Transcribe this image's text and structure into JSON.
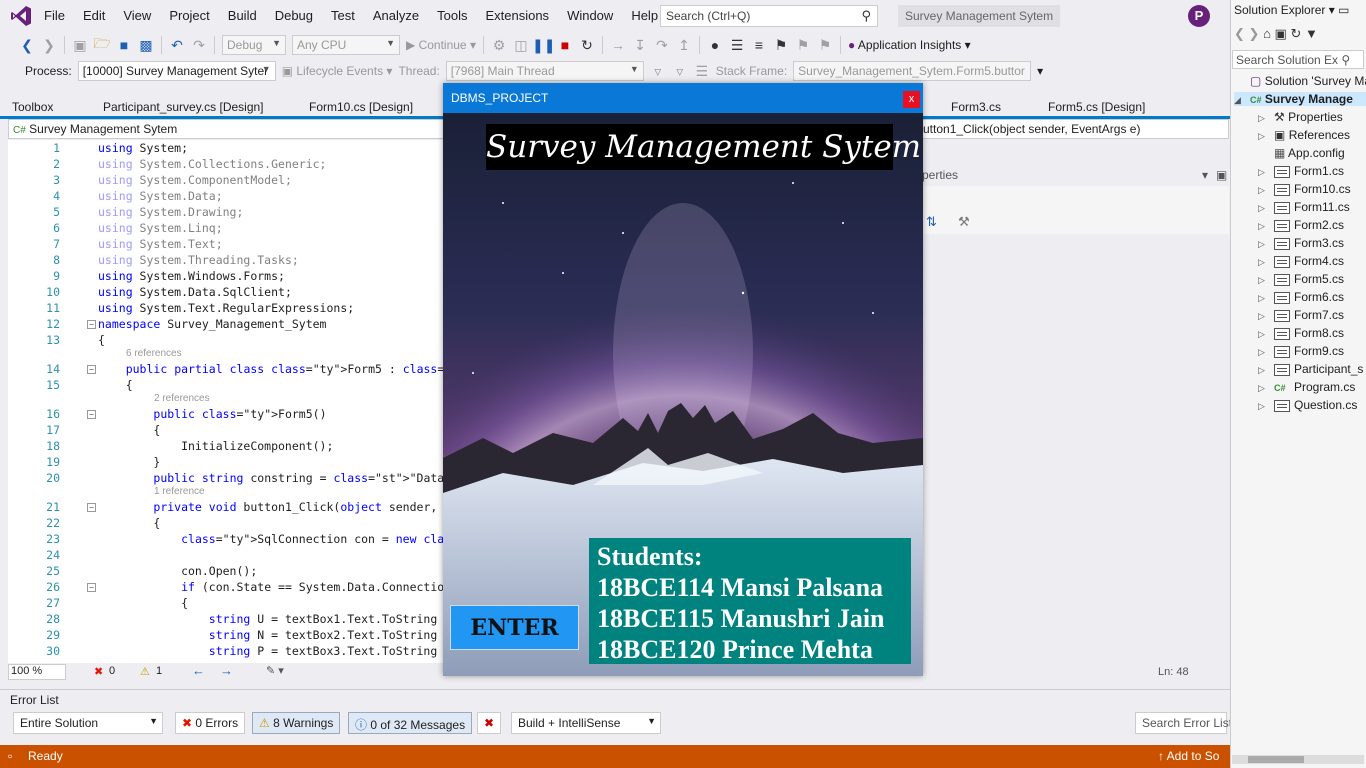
{
  "menu": {
    "items": [
      "File",
      "Edit",
      "View",
      "Project",
      "Build",
      "Debug",
      "Test",
      "Analyze",
      "Tools",
      "Extensions",
      "Window",
      "Help"
    ],
    "search_placeholder": "Search (Ctrl+Q)",
    "solution_title": "Survey Management Sytem",
    "profile_initial": "P"
  },
  "toolbar": {
    "config": "Debug",
    "platform": "Any CPU",
    "continue_label": "Continue",
    "app_insights": "Application Insights",
    "process_label": "Process:",
    "process_value": "[10000] Survey Management Syter",
    "lifecycle": "Lifecycle Events",
    "thread_label": "Thread:",
    "thread_value": "[7968] Main Thread",
    "stack_label": "Stack Frame:",
    "stack_value": "Survey_Management_Sytem.Form5.buttor"
  },
  "tabs": {
    "toolbox": "Toolbox",
    "items": [
      "Participant_survey.cs [Design]",
      "Form10.cs [Design]",
      "Form3.cs",
      "Form5.cs [Design]"
    ]
  },
  "editor": {
    "nav_project": "Survey Management Sytem",
    "nav_member": "utton1_Click(object sender, EventArgs e)",
    "zoom": "100 %",
    "errors": "0",
    "warnings": "1",
    "line_indicator": "Ln: 48",
    "properties_header": "perties"
  },
  "code": [
    {
      "n": "1",
      "t": "using System;"
    },
    {
      "n": "2",
      "t": "using System.Collections.Generic;"
    },
    {
      "n": "3",
      "t": "using System.ComponentModel;"
    },
    {
      "n": "4",
      "t": "using System.Data;"
    },
    {
      "n": "5",
      "t": "using System.Drawing;"
    },
    {
      "n": "6",
      "t": "using System.Linq;"
    },
    {
      "n": "7",
      "t": "using System.Text;"
    },
    {
      "n": "8",
      "t": "using System.Threading.Tasks;"
    },
    {
      "n": "9",
      "t": "using System.Windows.Forms;"
    },
    {
      "n": "10",
      "t": "using System.Data.SqlClient;"
    },
    {
      "n": "11",
      "t": "using System.Text.RegularExpressions;"
    },
    {
      "n": "12",
      "t": "namespace Survey_Management_Sytem"
    },
    {
      "n": "13",
      "t": "{"
    },
    {
      "n": "14",
      "t": "    public partial class Form5 : Form"
    },
    {
      "n": "15",
      "t": "    {"
    },
    {
      "n": "16",
      "t": "        public Form5()"
    },
    {
      "n": "17",
      "t": "        {"
    },
    {
      "n": "18",
      "t": "            InitializeComponent();"
    },
    {
      "n": "19",
      "t": "        }"
    },
    {
      "n": "20",
      "t": "        public string constring = \"Data Source=PRI"
    },
    {
      "n": "21",
      "t": "        private void button1_Click(object sender,"
    },
    {
      "n": "22",
      "t": "        {"
    },
    {
      "n": "23",
      "t": "            SqlConnection con = new SqlConnection"
    },
    {
      "n": "24",
      "t": ""
    },
    {
      "n": "25",
      "t": "            con.Open();"
    },
    {
      "n": "26",
      "t": "            if (con.State == System.Data.Connectio"
    },
    {
      "n": "27",
      "t": "            {"
    },
    {
      "n": "28",
      "t": "                string U = textBox1.Text.ToString"
    },
    {
      "n": "29",
      "t": "                string N = textBox2.Text.ToString"
    },
    {
      "n": "30",
      "t": "                string P = textBox3.Text.ToString"
    }
  ],
  "references": {
    "class_refs": "6 references",
    "ctor_refs": "2 references",
    "method_refs": "1 reference"
  },
  "error_list": {
    "title": "Error List",
    "scope": "Entire Solution",
    "errors": "0 Errors",
    "warnings": "8 Warnings",
    "messages": "0 of 32 Messages",
    "build": "Build + IntelliSense",
    "search": "Search Error List"
  },
  "statusbar": {
    "ready": "Ready",
    "add_source": "Add to So"
  },
  "solution_explorer": {
    "title": "Solution Explorer",
    "search": "Search Solution Ex",
    "solution": "Solution 'Survey Ma",
    "project": "Survey Manage",
    "items": [
      "Properties",
      "References",
      "App.config",
      "Form1.cs",
      "Form10.cs",
      "Form11.cs",
      "Form2.cs",
      "Form3.cs",
      "Form4.cs",
      "Form5.cs",
      "Form6.cs",
      "Form7.cs",
      "Form8.cs",
      "Form9.cs",
      "Participant_s",
      "Program.cs",
      "Question.cs"
    ]
  },
  "dialog": {
    "title": "DBMS_PROJECT",
    "close": "x",
    "app_title": "Survey Management Sytem",
    "enter": "ENTER",
    "students_heading": "Students:",
    "students": [
      "18BCE114 Mansi Palsana",
      "18BCE115 Manushri Jain",
      "18BCE120 Prince Mehta"
    ]
  },
  "colors": {
    "accent": "#007acc",
    "status_bar": "#ca5100",
    "dialog_titlebar": "#0a78d7",
    "enter_button": "#2196f3",
    "students_panel": "#00827f"
  }
}
